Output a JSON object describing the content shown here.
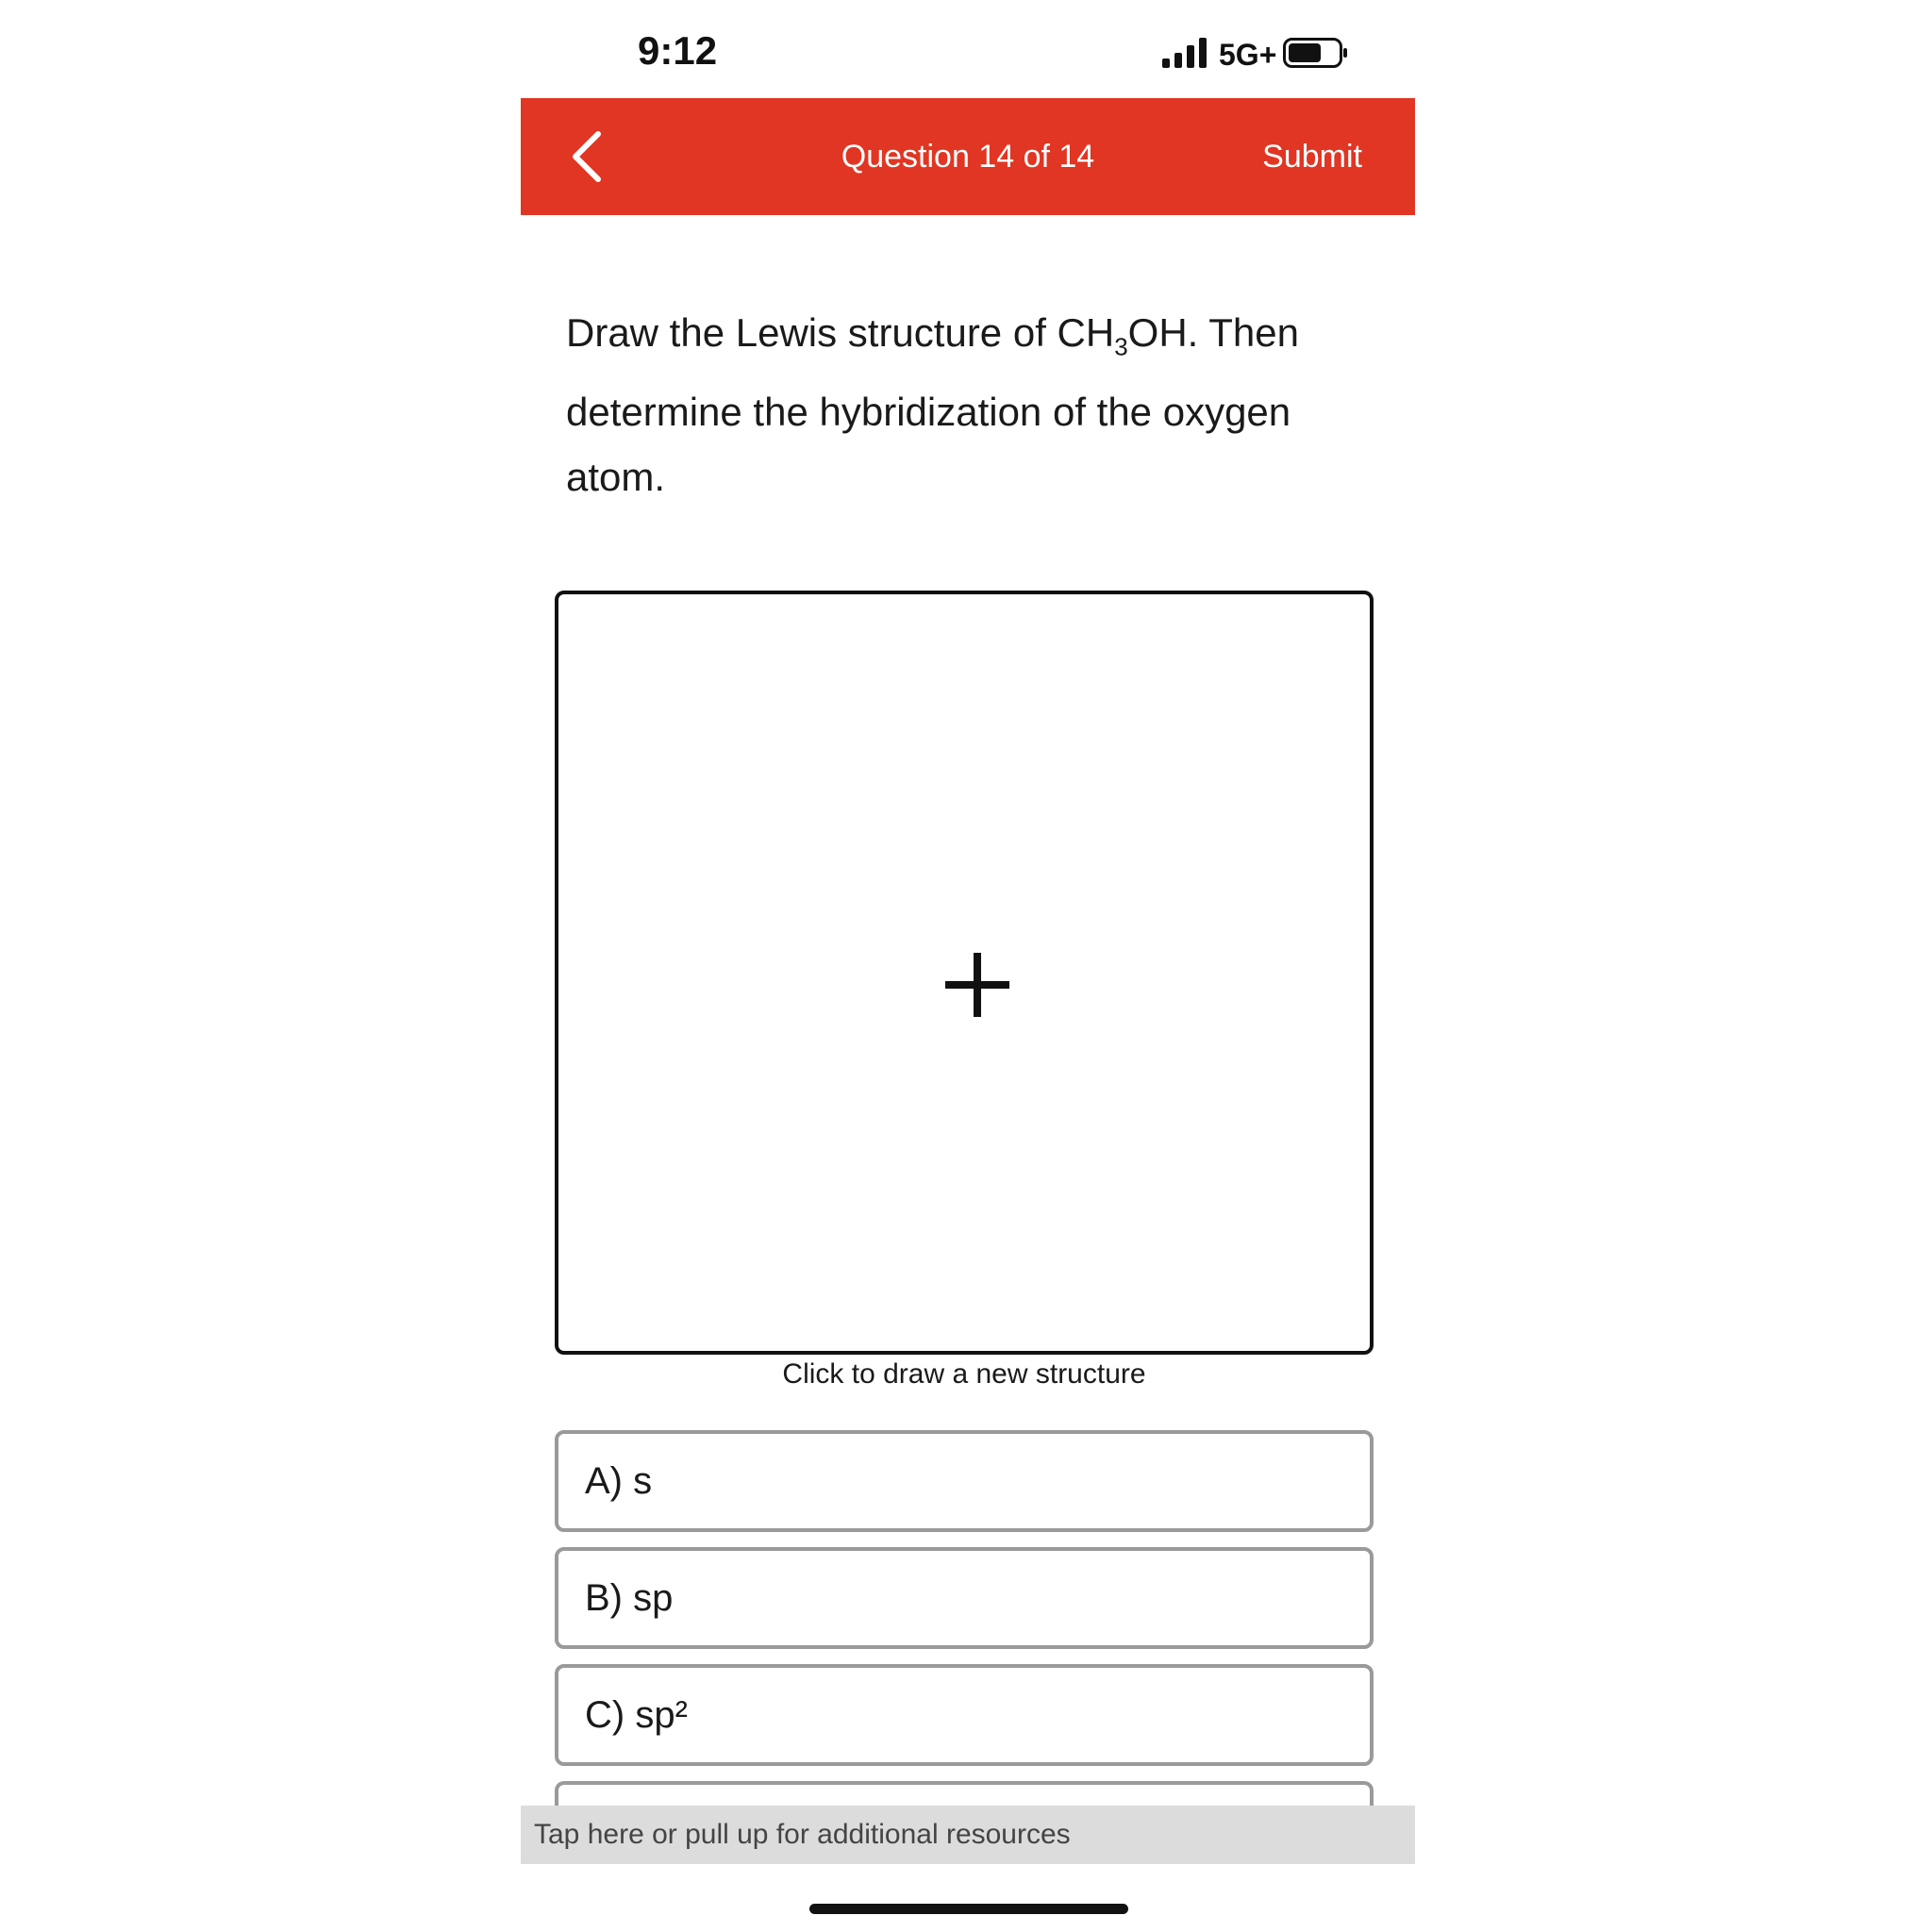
{
  "status_bar": {
    "time": "9:12",
    "network": "5G+",
    "icons": [
      "signal-icon",
      "battery-icon"
    ]
  },
  "header": {
    "title": "Question 14 of 14",
    "submit_label": "Submit",
    "background_color": "#e03623",
    "back_icon": "chevron-left-icon"
  },
  "question": {
    "text_part1": "Draw the Lewis structure of CH",
    "subscript": "3",
    "text_part2": "OH. Then determine the hybridization of the oxygen atom."
  },
  "drawing": {
    "caption": "Click to draw a new structure",
    "icon": "plus-icon"
  },
  "options": [
    {
      "label": "A) s"
    },
    {
      "label": "B) sp"
    },
    {
      "label": "C) sp²"
    }
  ],
  "resources": {
    "label": "Tap here or pull up for additional resources"
  }
}
